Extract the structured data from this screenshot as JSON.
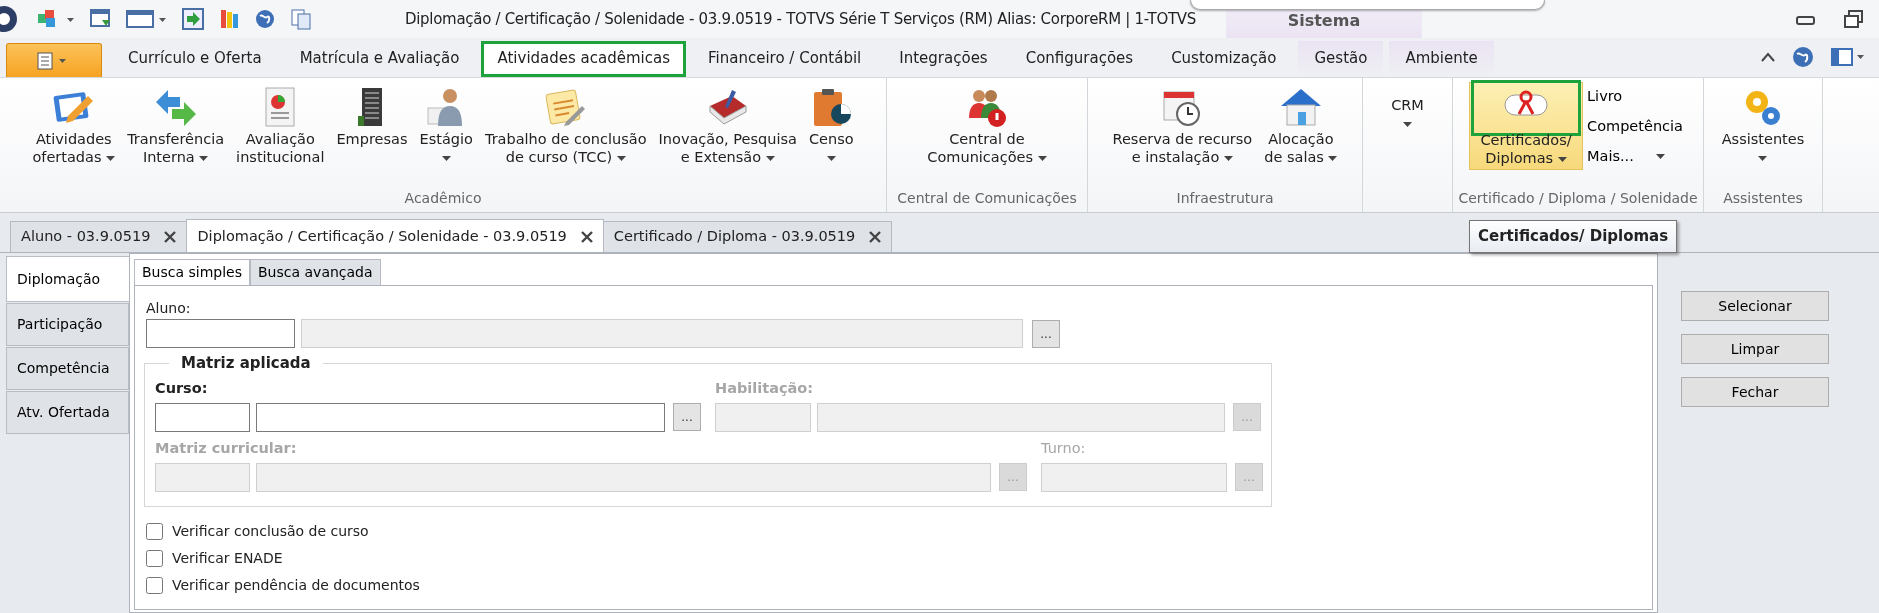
{
  "title_bar": {
    "title": "Diplomação / Certificação / Solenidade - 03.9.0519 - TOTVS Série T Serviços (RM) Alias: CorporeRM | 1-TOTVS",
    "context_label": "Sistema"
  },
  "ribbon_tabs": [
    {
      "label": "Currículo e Oferta",
      "selected": false,
      "contextual": false
    },
    {
      "label": "Matrícula e Avaliação",
      "selected": false,
      "contextual": false
    },
    {
      "label": "Atividades acadêmicas",
      "selected": true,
      "contextual": false
    },
    {
      "label": "Financeiro / Contábil",
      "selected": false,
      "contextual": false
    },
    {
      "label": "Integrações",
      "selected": false,
      "contextual": false
    },
    {
      "label": "Configurações",
      "selected": false,
      "contextual": false
    },
    {
      "label": "Customização",
      "selected": false,
      "contextual": false
    },
    {
      "label": "Gestão",
      "selected": false,
      "contextual": true
    },
    {
      "label": "Ambiente",
      "selected": false,
      "contextual": true
    }
  ],
  "ribbon_groups": [
    {
      "label": "Acadêmico",
      "items": [
        {
          "kind": "large",
          "label": "Atividades\nofertadas",
          "dropdown": true,
          "selected": false
        },
        {
          "kind": "large",
          "label": "Transferência\nInterna",
          "dropdown": true,
          "selected": false
        },
        {
          "kind": "large",
          "label": "Avaliação\ninstitucional",
          "dropdown": false,
          "selected": false
        },
        {
          "kind": "large",
          "label": "Empresas",
          "dropdown": false,
          "selected": false
        },
        {
          "kind": "large",
          "label": "Estágio",
          "dropdown": true,
          "selected": false
        },
        {
          "kind": "large",
          "label": "Trabalho de conclusão\nde curso (TCC)",
          "dropdown": true,
          "selected": false
        },
        {
          "kind": "large",
          "label": "Inovação, Pesquisa\ne Extensão",
          "dropdown": true,
          "selected": false
        },
        {
          "kind": "large",
          "label": "Censo",
          "dropdown": true,
          "selected": false
        }
      ]
    },
    {
      "label": "Central de Comunicações",
      "items": [
        {
          "kind": "large",
          "label": "Central de\nComunicações",
          "dropdown": true,
          "selected": false
        }
      ]
    },
    {
      "label": "Infraestrutura",
      "items": [
        {
          "kind": "large",
          "label": "Reserva de recurso\ne instalação",
          "dropdown": true,
          "selected": false
        },
        {
          "kind": "large",
          "label": "Alocação\nde salas",
          "dropdown": true,
          "selected": false
        }
      ]
    },
    {
      "items": [
        {
          "kind": "text",
          "label": "CRM",
          "dropdown": true,
          "selected": false
        }
      ]
    },
    {
      "label": "Certificado / Diploma / Solenidade",
      "items": [
        {
          "kind": "large",
          "label": "Certificados/\nDiplomas",
          "dropdown": true,
          "selected": true
        },
        {
          "kind": "small",
          "label": "Livro",
          "dropdown": false,
          "selected": false
        },
        {
          "kind": "small",
          "label": "Competência",
          "dropdown": false,
          "selected": false
        },
        {
          "kind": "small",
          "label": "Mais...",
          "dropdown": true,
          "selected": false
        }
      ]
    },
    {
      "label": "Assistentes",
      "items": [
        {
          "kind": "large",
          "label": "Assistentes",
          "dropdown": true,
          "selected": false
        }
      ]
    }
  ],
  "tooltip": "Certificados/ Diplomas",
  "document_tabs": [
    {
      "label": "Aluno - 03.9.0519",
      "selected": false
    },
    {
      "label": "Diplomação / Certificação / Solenidade - 03.9.0519",
      "selected": true
    },
    {
      "label": "Certificado / Diploma - 03.9.0519",
      "selected": false
    }
  ],
  "side_tabs": [
    {
      "label": "Diplomação",
      "selected": true
    },
    {
      "label": "Participação",
      "selected": false
    },
    {
      "label": "Competência",
      "selected": false
    },
    {
      "label": "Atv. Ofertada",
      "selected": false
    }
  ],
  "search_tabs": [
    {
      "label": "Busca simples",
      "selected": true
    },
    {
      "label": "Busca avançada",
      "selected": false
    }
  ],
  "form": {
    "student": {
      "label": "Aluno:",
      "lookup": "..."
    },
    "group": {
      "legend": "Matriz aplicada",
      "rows": [
        [
          {
            "kind": "pair",
            "label": "Curso:",
            "enabled": true,
            "required": true,
            "lookup": "..."
          },
          {
            "kind": "pair",
            "label": "Habilitação:",
            "enabled": false,
            "required": true,
            "lookup": "..."
          }
        ],
        [
          {
            "kind": "pair",
            "label": "Matriz curricular:",
            "enabled": false,
            "required": true,
            "lookup": "..."
          },
          {
            "kind": "single",
            "label": "Turno:",
            "enabled": false,
            "required": false,
            "lookup": "..."
          }
        ]
      ]
    },
    "checks": [
      {
        "label": "Verificar conclusão de curso",
        "checked": false
      },
      {
        "label": "Verificar ENADE",
        "checked": false
      },
      {
        "label": "Verificar pendência de documentos",
        "checked": false
      }
    ]
  },
  "buttons": [
    "Selecionar",
    "Limpar",
    "Fechar"
  ]
}
